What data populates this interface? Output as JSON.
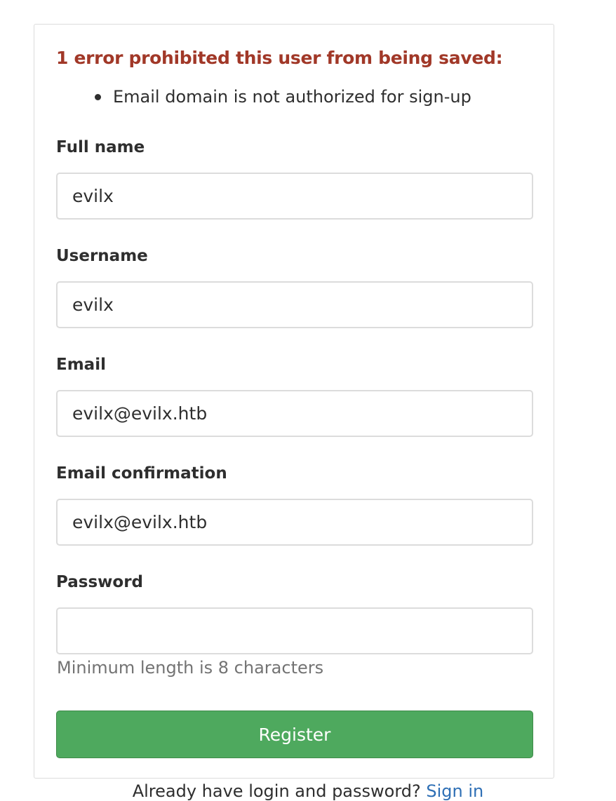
{
  "errors": {
    "title": "1 error prohibited this user from being saved:",
    "items": [
      "Email domain is not authorized for sign-up"
    ],
    "color": "#a13828"
  },
  "form": {
    "full_name": {
      "label": "Full name",
      "value": "evilx"
    },
    "username": {
      "label": "Username",
      "value": "evilx"
    },
    "email": {
      "label": "Email",
      "value": "evilx@evilx.htb"
    },
    "email_confirmation": {
      "label": "Email confirmation",
      "value": "evilx@evilx.htb"
    },
    "password": {
      "label": "Password",
      "value": "",
      "hint": "Minimum length is 8 characters"
    },
    "submit_label": "Register",
    "submit_color": "#4ea95e"
  },
  "footer": {
    "text": "Already have login and password?",
    "link_label": "Sign in",
    "link_color": "#2e6fb5"
  }
}
